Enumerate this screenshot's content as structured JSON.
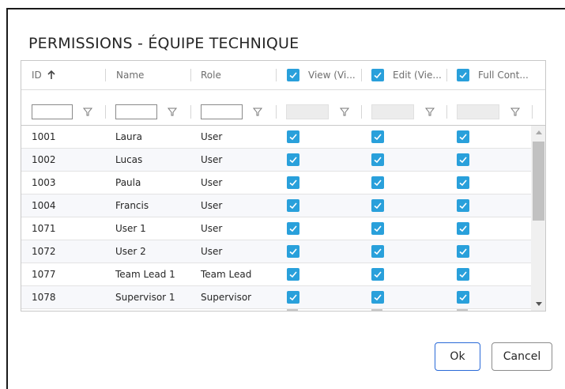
{
  "dialog": {
    "title": "PERMISSIONS - ÉQUIPE TECHNIQUE",
    "ok_label": "Ok",
    "cancel_label": "Cancel"
  },
  "colors": {
    "checkbox_accent": "#29a0db",
    "primary_button_border": "#2a6ad8"
  },
  "grid": {
    "columns": {
      "id": {
        "label": "ID",
        "sort_icon": "arrow-up-icon"
      },
      "name": {
        "label": "Name"
      },
      "role": {
        "label": "Role"
      },
      "view": {
        "label": "View (Vi...",
        "checked": true
      },
      "edit": {
        "label": "Edit (Vie...",
        "checked": true
      },
      "full": {
        "label": "Full Cont...",
        "checked": true
      }
    },
    "rows": [
      {
        "id": "1001",
        "name": "Laura",
        "role": "User",
        "view": true,
        "edit": true,
        "full": true
      },
      {
        "id": "1002",
        "name": "Lucas",
        "role": "User",
        "view": true,
        "edit": true,
        "full": true
      },
      {
        "id": "1003",
        "name": "Paula",
        "role": "User",
        "view": true,
        "edit": true,
        "full": true
      },
      {
        "id": "1004",
        "name": "Francis",
        "role": "User",
        "view": true,
        "edit": true,
        "full": true
      },
      {
        "id": "1071",
        "name": "User 1",
        "role": "User",
        "view": true,
        "edit": true,
        "full": true
      },
      {
        "id": "1072",
        "name": "User 2",
        "role": "User",
        "view": true,
        "edit": true,
        "full": true
      },
      {
        "id": "1077",
        "name": "Team Lead 1",
        "role": "Team Lead",
        "view": true,
        "edit": true,
        "full": true
      },
      {
        "id": "1078",
        "name": "Supervisor 1",
        "role": "Supervisor",
        "view": true,
        "edit": true,
        "full": true
      }
    ]
  }
}
